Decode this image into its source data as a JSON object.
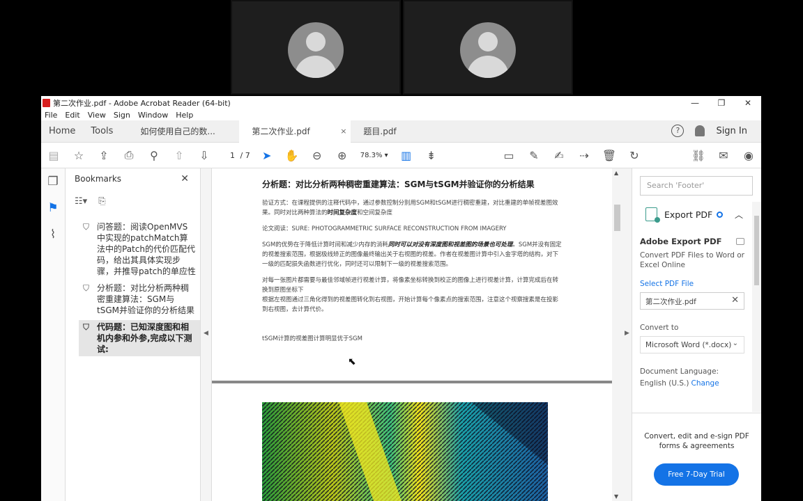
{
  "window": {
    "title": "第二次作业.pdf - Adobe Acrobat Reader (64-bit)",
    "controls": [
      "—",
      "❐",
      "✕"
    ]
  },
  "menu": [
    "File",
    "Edit",
    "View",
    "Sign",
    "Window",
    "Help"
  ],
  "tabs": {
    "home": "Home",
    "tools": "Tools",
    "docs": [
      {
        "label": "如何使用自己的数...",
        "active": false
      },
      {
        "label": "第二次作业.pdf",
        "active": true,
        "close": "×"
      },
      {
        "label": "题目.pdf",
        "active": false
      }
    ],
    "help": "?",
    "signin": "Sign In"
  },
  "toolbar": {
    "page_current": "1",
    "page_total": "/ 7",
    "zoom": "78.3%"
  },
  "bookmarks": {
    "title": "Bookmarks",
    "close": "✕",
    "items": [
      {
        "label": "问答题：阅读OpenMVS中实现的patchMatch算法中的Patch的代价匹配代码，给出其具体实现步骤，并推导patch的单应性矩阵H",
        "selected": false
      },
      {
        "label": "分析题：对比分析两种稠密重建算法：SGM与tSGM并验证你的分析结果",
        "selected": false
      },
      {
        "label": "代码题：已知深度图和相机内参和外参,完成以下测试:",
        "selected": true
      }
    ]
  },
  "document": {
    "heading": "分析题：对比分析两种稠密重建算法：SGM与tSGM并验证你的分析结果",
    "p1_a": "验证方式：在课程提供的注释代码中，通过参数控制分别用SGM和tSGM进行稠密重建，对比重建的单帧视差图效果。同时对比两种算法的",
    "p1_b": "时间复杂度",
    "p1_c": "和空间复杂度",
    "p2": "论文阅读：SURE: PHOTOGRAMMETRIC SURFACE RECONSTRUCTION FROM IMAGERY",
    "p3_a": "SGM的优势在于降低计算时间和减少内存的消耗",
    "p3_b": "同时可以对没有深度图和视差图的场景也可处理",
    "p3_c": "。SGM并没有固定的视差搜索范围，根据极线矫正的图像最终输出关于右视图的视差。作者在视差图计算中引入金字塔的结构，对下一级的匹配损失函数进行优化，同时还可以限制下一级的视差搜索范围。",
    "p4": "对每一张图片都需要与最佳邻域帧进行视差计算，将像素坐标转换到校正的图像上进行视差计算，计算完成后在转换到原图坐标下",
    "p5": "根据左视图通过三角化得到的视差图转化到右视图，开始计算每个像素点的搜索范围，注意这个视察搜素是在投影到右视图，去计算代价。",
    "p6": "tSGM计算的视差图计算明显优于SGM"
  },
  "right_panel": {
    "search_placeholder": "Search 'Footer'",
    "export_title": "Export PDF",
    "section_title": "Adobe Export PDF",
    "description": "Convert PDF Files to Word or Excel Online",
    "select_file": "Select PDF File",
    "file_name": "第二次作业.pdf",
    "file_remove": "✕",
    "convert_label": "Convert to",
    "convert_value": "Microsoft Word (*.docx)",
    "language_label": "Document Language:",
    "language_value": "English (U.S.)",
    "language_change": "Change",
    "promo": "Convert, edit and e-sign PDF forms & agreements",
    "trial_button": "Free 7-Day Trial"
  },
  "icons": {
    "save": "save-icon",
    "bookmark_star": "star-icon",
    "upload": "upload-icon",
    "print": "print-icon",
    "zoom_search": "magnifier-icon",
    "prev": "arrow-up-icon",
    "next": "arrow-down-icon",
    "select": "cursor-arrow-icon",
    "hand": "hand-icon",
    "zoom_out": "zoom-out-icon",
    "zoom_in": "zoom-in-icon"
  },
  "colors": {
    "accent": "#1473e6",
    "export_teal": "#3b9b8c"
  }
}
